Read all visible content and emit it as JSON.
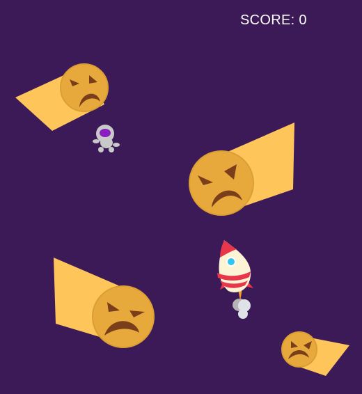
{
  "hud": {
    "score_text": "SCORE: 0"
  },
  "colors": {
    "background": "#3b1a57",
    "meteor_trail": "#fdc55a",
    "meteor_face": "#e8a93c",
    "meteor_face_shadow": "#d9942a",
    "meteor_features": "#7a3e1a",
    "rocket_body": "#fdf3d5",
    "rocket_stripe": "#e8374b",
    "rocket_window": "#32c3ef",
    "astronaut_suit": "#c9c9c9",
    "astronaut_visor": "#8a1cc2"
  },
  "sprites": {
    "meteors": [
      "angry-meteor",
      "angry-meteor",
      "angry-meteor",
      "angry-meteor"
    ],
    "player": "rocket",
    "pickup": "astronaut"
  }
}
